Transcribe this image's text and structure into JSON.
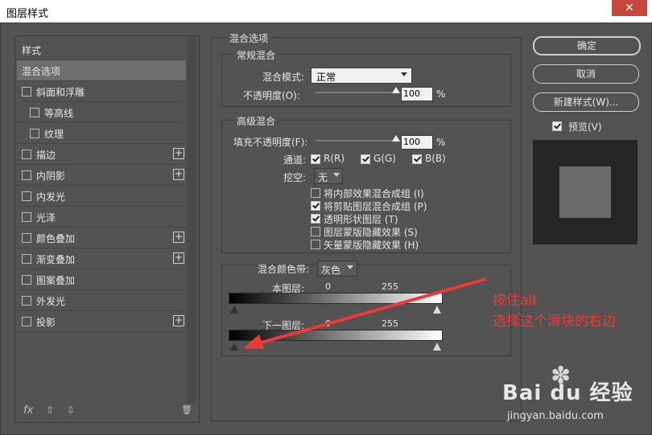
{
  "window": {
    "title": "图层样式",
    "close": "✕"
  },
  "sidebar": {
    "items": [
      {
        "label": "样式",
        "checkbox": false,
        "plus": false,
        "indent": 0,
        "selected": false
      },
      {
        "label": "混合选项",
        "checkbox": false,
        "plus": false,
        "indent": 0,
        "selected": true
      },
      {
        "label": "斜面和浮雕",
        "checkbox": true,
        "plus": false,
        "indent": 0,
        "selected": false
      },
      {
        "label": "等高线",
        "checkbox": true,
        "plus": false,
        "indent": 1,
        "selected": false
      },
      {
        "label": "纹理",
        "checkbox": true,
        "plus": false,
        "indent": 1,
        "selected": false
      },
      {
        "label": "描边",
        "checkbox": true,
        "plus": true,
        "indent": 0,
        "selected": false
      },
      {
        "label": "内阴影",
        "checkbox": true,
        "plus": true,
        "indent": 0,
        "selected": false
      },
      {
        "label": "内发光",
        "checkbox": true,
        "plus": false,
        "indent": 0,
        "selected": false
      },
      {
        "label": "光泽",
        "checkbox": true,
        "plus": false,
        "indent": 0,
        "selected": false
      },
      {
        "label": "颜色叠加",
        "checkbox": true,
        "plus": true,
        "indent": 0,
        "selected": false
      },
      {
        "label": "渐变叠加",
        "checkbox": true,
        "plus": true,
        "indent": 0,
        "selected": false
      },
      {
        "label": "图案叠加",
        "checkbox": true,
        "plus": false,
        "indent": 0,
        "selected": false
      },
      {
        "label": "外发光",
        "checkbox": true,
        "plus": false,
        "indent": 0,
        "selected": false
      },
      {
        "label": "投影",
        "checkbox": true,
        "plus": true,
        "indent": 0,
        "selected": false
      }
    ],
    "footer": {
      "fx": "fx",
      "up": "⇧",
      "down": "⇩",
      "trash": "🗑"
    }
  },
  "blend": {
    "title": "混合选项",
    "general": {
      "title": "常规混合",
      "mode_label": "混合模式:",
      "mode_value": "正常",
      "opacity_label": "不透明度(O):",
      "opacity_value": "100",
      "opacity_unit": "%",
      "opacity_level": 1.0
    },
    "advanced": {
      "title": "高级混合",
      "fill_label": "填充不透明度(F):",
      "fill_value": "100",
      "fill_unit": "%",
      "fill_level": 1.0,
      "channels_label": "通道:",
      "channel_r": "R(R)",
      "channel_g": "G(G)",
      "channel_b": "B(B)",
      "knockout_label": "挖空:",
      "knockout_value": "无",
      "options": [
        {
          "label": "将内部效果混合成组 (I)",
          "checked": false
        },
        {
          "label": "将剪贴图层混合成组 (P)",
          "checked": true
        },
        {
          "label": "透明形状图层 (T)",
          "checked": true
        },
        {
          "label": "图层蒙版隐藏效果 (S)",
          "checked": false
        },
        {
          "label": "矢量蒙版隐藏效果 (H)",
          "checked": false
        }
      ]
    },
    "blend_if": {
      "label": "混合颜色带:",
      "value": "灰色",
      "this_layer_label": "本图层:",
      "this_min": "0",
      "this_max": "255",
      "under_layer_label": "下一图层:",
      "under_min": "0",
      "under_max": "255"
    }
  },
  "buttons": {
    "ok": "确定",
    "cancel": "取消",
    "new_style": "新建样式(W)...",
    "preview_label": "预览(V)"
  },
  "annotation": {
    "line1": "按住alt",
    "line2": "选择这个滑块的右边",
    "color": "#ef3a3a"
  },
  "watermark": {
    "brand": "Bai du 经验",
    "url": "jingyan.baidu.com"
  }
}
